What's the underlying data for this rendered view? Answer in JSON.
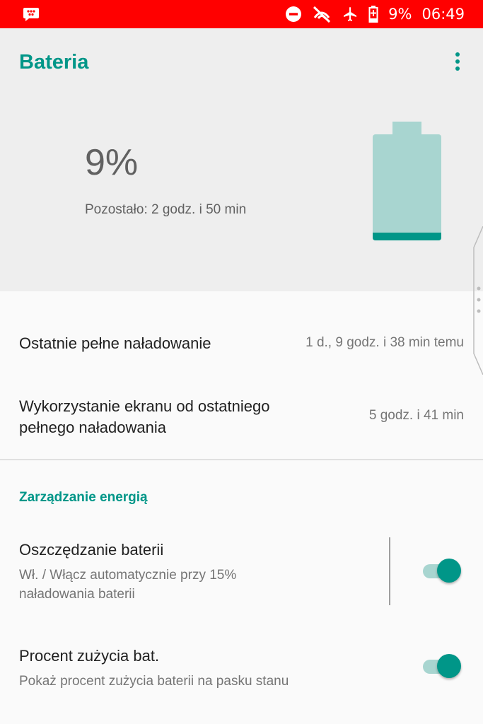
{
  "status_bar": {
    "battery_percent": "9%",
    "time": "06:49",
    "icons": [
      "bbm-icon",
      "do-not-disturb-icon",
      "no-signal-icon",
      "airplane-mode-icon",
      "battery-charging-icon"
    ],
    "color": "#ff0000"
  },
  "app": {
    "title": "Bateria",
    "accent": "#009688"
  },
  "battery": {
    "percent": "9%",
    "level": 0.09,
    "remaining": "Pozostało: 2 godz. i 50 min"
  },
  "details": [
    {
      "label": "Ostatnie pełne naładowanie",
      "value": "1 d., 9 godz. i 38 min temu"
    },
    {
      "label_line1": "Wykorzystanie ekranu od ostatniego",
      "label_line2": "pełnego naładowania",
      "value": "5 godz. i 41 min"
    }
  ],
  "power_management": {
    "header": "Zarządzanie energią",
    "items": [
      {
        "title": "Oszczędzanie baterii",
        "summary_line1": "Wł. / Włącz automatycznie przy 15%",
        "summary_line2": "naładowania baterii",
        "enabled": true
      },
      {
        "title": "Procent zużycia bat.",
        "summary_line1": "Pokaż procent zużycia baterii na pasku stanu",
        "enabled": true
      }
    ]
  }
}
